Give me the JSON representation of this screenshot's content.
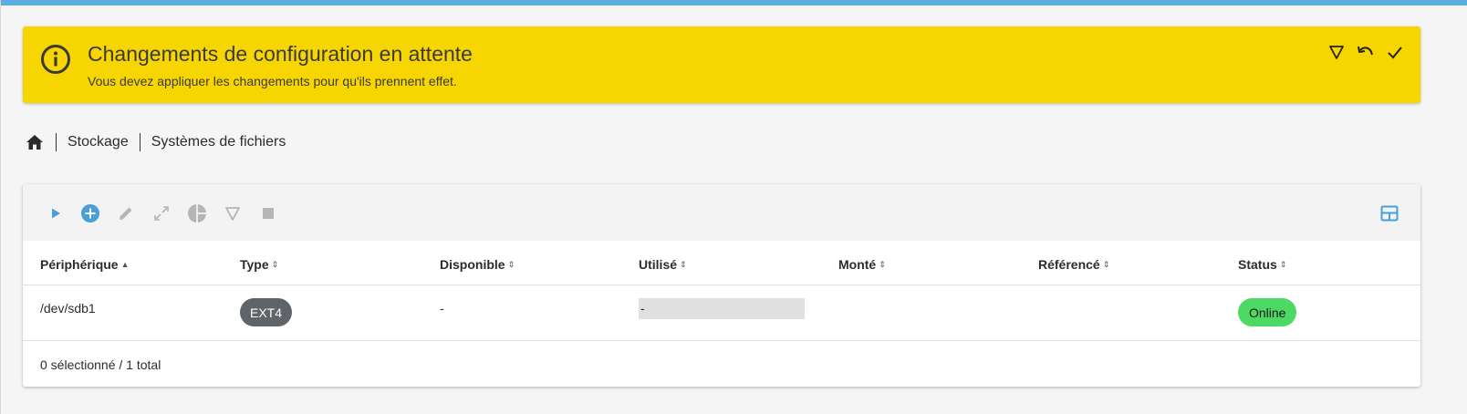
{
  "alert": {
    "title": "Changements de configuration en attente",
    "message": "Vous devez appliquer les changements pour qu'ils prennent effet.",
    "background": "#f7d500",
    "icon": "info-icon",
    "actions": [
      {
        "name": "filter-icon"
      },
      {
        "name": "undo-icon"
      },
      {
        "name": "check-icon"
      }
    ]
  },
  "breadcrumb": {
    "home_icon": "home-icon",
    "items": [
      "Stockage",
      "Systèmes de fichiers"
    ]
  },
  "toolbar": {
    "buttons": [
      {
        "icon": "play-icon",
        "enabled": true
      },
      {
        "icon": "add-circle-icon",
        "enabled": true
      },
      {
        "icon": "pencil-icon",
        "enabled": false
      },
      {
        "icon": "expand-icon",
        "enabled": false
      },
      {
        "icon": "pie-chart-icon",
        "enabled": false
      },
      {
        "icon": "filter-icon",
        "enabled": false
      },
      {
        "icon": "stop-icon",
        "enabled": false
      }
    ],
    "grid_icon": "table-layout-icon",
    "accent": "#4a9fd8"
  },
  "table": {
    "columns": [
      "Périphérique",
      "Type",
      "Disponible",
      "Utilisé",
      "Monté",
      "Référencé",
      "Status"
    ],
    "rows": [
      {
        "device": "/dev/sdb1",
        "type": "EXT4",
        "available": "-",
        "used": "-",
        "mounted": "",
        "referenced": "",
        "status": "Online"
      }
    ]
  },
  "footer": {
    "summary": "0 sélectionné / 1 total"
  }
}
